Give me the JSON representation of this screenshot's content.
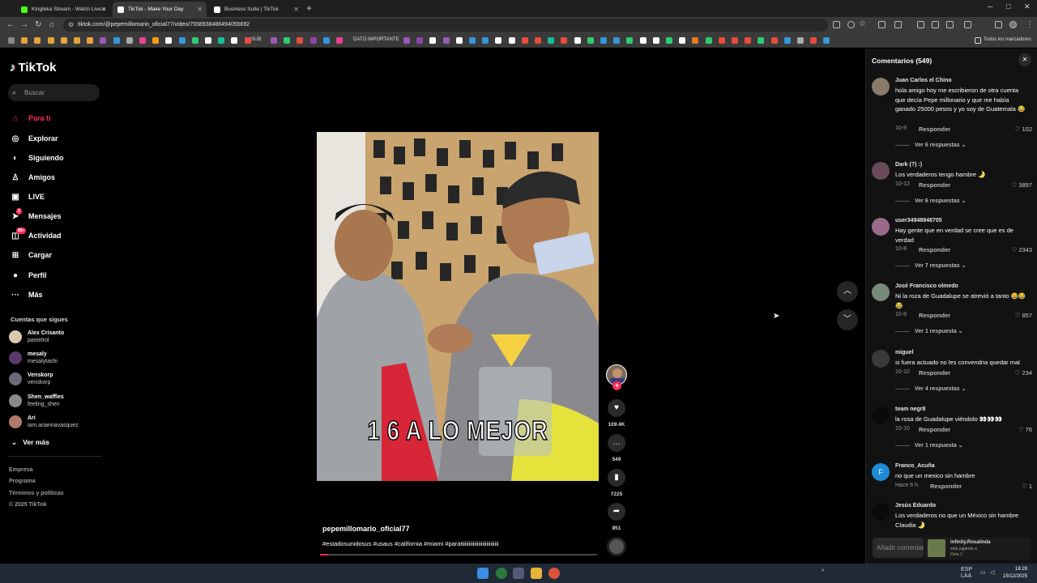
{
  "browser": {
    "tabs": [
      {
        "title": "Kingteka Stream - Watch Live o",
        "icon_color": "#53fc18",
        "active": false
      },
      {
        "title": "TikTok - Make Your Day",
        "icon_color": "#ffffff",
        "active": true
      },
      {
        "title": "Business Suite | TikTok",
        "icon_color": "#ffffff",
        "active": false
      }
    ],
    "new_tab": "+",
    "url": "tiktok.com/@pepemillomario_oficial77/video/7558938486494055692",
    "bookmark_label_1": "SUB",
    "bookmark_label_2": "DATO IMPORTANTE",
    "all_bookmarks": "Todos los marcadores"
  },
  "sidebar": {
    "logo": "TikTok",
    "search_placeholder": "Buscar",
    "nav": [
      {
        "label": "Para ti",
        "icon": "home-icon",
        "glyph": "⌂",
        "active": true
      },
      {
        "label": "Explorar",
        "icon": "compass-icon",
        "glyph": "◎",
        "active": false
      },
      {
        "label": "Siguiendo",
        "icon": "following-icon",
        "glyph": "◐",
        "active": false
      },
      {
        "label": "Amigos",
        "icon": "friends-icon",
        "glyph": "♙",
        "active": false
      },
      {
        "label": "LIVE",
        "icon": "live-icon",
        "glyph": "▣",
        "active": false
      },
      {
        "label": "Mensajes",
        "icon": "messages-icon",
        "glyph": "➤",
        "badge": "2",
        "active": false
      },
      {
        "label": "Actividad",
        "icon": "activity-icon",
        "glyph": "◫",
        "badge": "99+",
        "active": false
      },
      {
        "label": "Cargar",
        "icon": "upload-icon",
        "glyph": "⊞",
        "active": false
      },
      {
        "label": "Perfil",
        "icon": "profile-icon",
        "glyph": "●",
        "active": false
      },
      {
        "label": "Más",
        "icon": "more-icon",
        "glyph": "···",
        "active": false
      }
    ],
    "following_title": "Cuentas que sigues",
    "following": [
      {
        "name": "Alex Crisanto",
        "username": "pastelrol",
        "color": "#d9c9b0"
      },
      {
        "name": "mesaly",
        "username": "mesalytashi",
        "color": "#5a3a6a"
      },
      {
        "name": "Venskorp",
        "username": "venskorp",
        "color": "#6a6a7a"
      },
      {
        "name": "Shen_waffles",
        "username": "feeling_shen",
        "color": "#8a8a8a"
      },
      {
        "name": "Ari",
        "username": "iam.ariannavasquez",
        "color": "#b07a6a"
      }
    ],
    "see_more": "Ver más",
    "footer": [
      "Empresa",
      "Programa",
      "Términos y políticas",
      "© 2025 TikTok"
    ]
  },
  "video": {
    "overlay_text": "1 6 A LO MEJOR",
    "author": "pepemillomario_oficial77",
    "hashtags": "#estadosunidosus #usaus #california #miami #paratiiiiiiiiiiiiiiiiiiiiiiiiiii",
    "progress": 0.03,
    "likes": "109.4K",
    "comments": "549",
    "saves": "7225",
    "shares": "851"
  },
  "comments_panel": {
    "title": "Comentarios (549)",
    "reply_label": "Responder",
    "input_placeholder": "Añadir comentario...",
    "items": [
      {
        "user": "Juan Carlos el Chino",
        "text": "hola amigo hoy me escribieron de otra cuenta que decía Pepe millonario y que me había ganado 25000 pesos y yo soy de Guatemala 😂",
        "date": "10-9",
        "likes": "102",
        "replies": "Ver 6 respuestas",
        "color": "#8a7a6a"
      },
      {
        "user": "Dark (?) :)",
        "text": "Los verdaderos tengo hambre 🌛",
        "date": "10-12",
        "likes": "3897",
        "replies": "Ver 6 respuestas",
        "color": "#6a4a5a"
      },
      {
        "user": "user34948948705",
        "text": "Hay gente que en verdad se cree que es de verdad",
        "date": "10-8",
        "likes": "2343",
        "replies": "Ver 7 respuestas",
        "color": "#9a6a8a"
      },
      {
        "user": "José Francisco olmedo",
        "text": "Ni la roza de Guadalupe se atrevió a tanto 😂😂😂",
        "date": "10-8",
        "likes": "857",
        "replies": "Ver 1 respuesta",
        "color": "#7a8a7a"
      },
      {
        "user": "miguel",
        "text": "si fuera actuado no les convendria quedar mal",
        "date": "10-10",
        "likes": "234",
        "replies": "Ver 4 respuestas",
        "color": "#3a3a3a"
      },
      {
        "user": "team negr8",
        "text": "la rosa de Guadalupe viéndolo 👀👀👀",
        "date": "10-10",
        "likes": "76",
        "replies": "Ver 1 respuesta",
        "color": "#0a0a0a"
      },
      {
        "user": "Franco_Acuña",
        "text": "no que un mexico sin hambre",
        "date": "Hace 6 h",
        "likes": "1",
        "replies": "",
        "color": "#1d8ad6",
        "initial": "F"
      },
      {
        "user": "Jesús Eduardo",
        "text": "Los verdaderos no que un México sin hambre Claudia 🌛",
        "date": "",
        "likes": "",
        "replies": "",
        "color": "#0a0a0a"
      }
    ]
  },
  "toast": {
    "name": "infinity.Rosalinda",
    "status": "está jugando a",
    "game": "Dota 2"
  },
  "taskbar": {
    "lang": "ESP",
    "lang2": "LAA",
    "time": "18:28",
    "date": "15/12/2025"
  }
}
